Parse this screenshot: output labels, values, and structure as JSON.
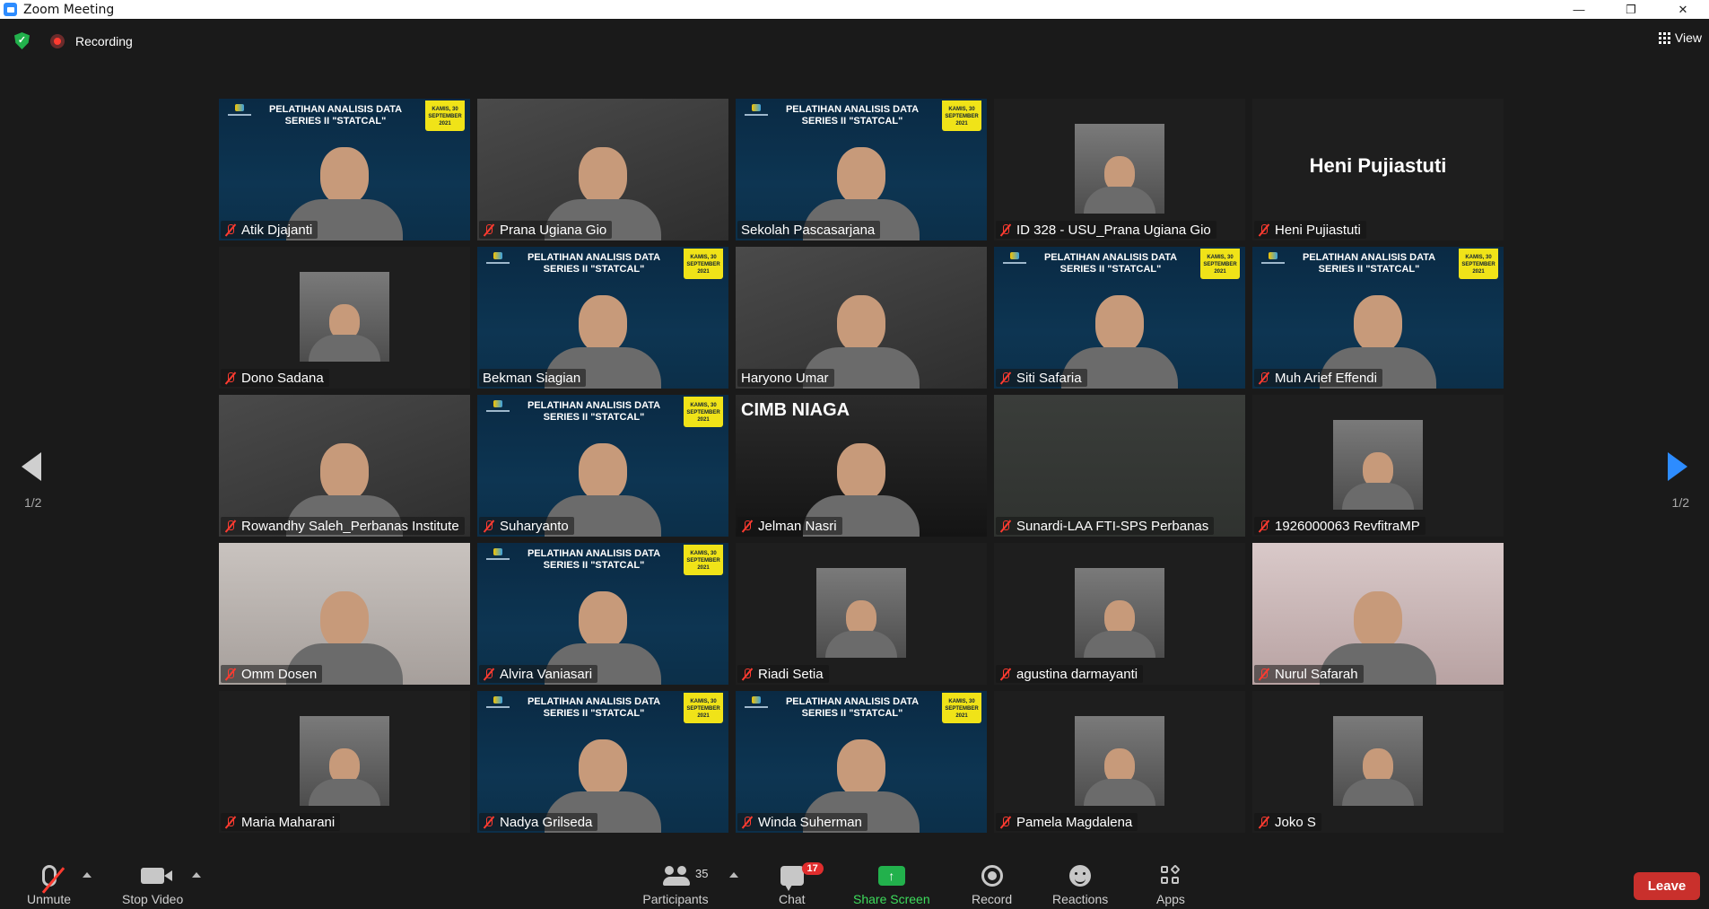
{
  "window": {
    "title": "Zoom Meeting",
    "minimize": "—",
    "restore": "❐",
    "close": "✕"
  },
  "topbar": {
    "recording_label": "Recording",
    "view_label": "View"
  },
  "banner": {
    "title": "PELATIHAN ANALISIS DATA SERIES II \"STATCAL\"",
    "date": "KAMIS, 30 SEPTEMBER 2021"
  },
  "tiles": [
    {
      "name": "Atik Djajanti",
      "muted": true,
      "bg": "banner"
    },
    {
      "name": "Prana Ugiana Gio",
      "muted": true,
      "bg": "room"
    },
    {
      "name": "Sekolah Pascasarjana",
      "muted": false,
      "bg": "banner",
      "active_speaker": true
    },
    {
      "name": "ID 328 - USU_Prana Ugiana Gio",
      "muted": true,
      "bg": "dark"
    },
    {
      "name": "Heni Pujiastuti",
      "muted": true,
      "bg": "dark",
      "display_name_card": "Heni Pujiastuti"
    },
    {
      "name": "Dono Sadana",
      "muted": true,
      "bg": "dark"
    },
    {
      "name": "Bekman Siagian",
      "muted": false,
      "bg": "banner"
    },
    {
      "name": "Haryono Umar",
      "muted": false,
      "bg": "room"
    },
    {
      "name": "Siti Safaria",
      "muted": true,
      "bg": "banner"
    },
    {
      "name": "Muh Arief Effendi",
      "muted": true,
      "bg": "banner"
    },
    {
      "name": "Rowandhy Saleh_Perbanas Institute",
      "muted": true,
      "bg": "room"
    },
    {
      "name": "Suharyanto",
      "muted": true,
      "bg": "banner"
    },
    {
      "name": "Jelman Nasri",
      "muted": true,
      "bg": "cimb",
      "overlay": "CIMB NIAGA"
    },
    {
      "name": "Sunardi-LAA FTI-SPS Perbanas",
      "muted": true,
      "bg": "grey"
    },
    {
      "name": "1926000063 RevfitraMP",
      "muted": true,
      "bg": "dark"
    },
    {
      "name": "Omm Dosen",
      "muted": true,
      "bg": "light"
    },
    {
      "name": "Alvira Vaniasari",
      "muted": true,
      "bg": "banner"
    },
    {
      "name": "Riadi Setia",
      "muted": true,
      "bg": "dark"
    },
    {
      "name": "agustina darmayanti",
      "muted": true,
      "bg": "dark"
    },
    {
      "name": "Nurul Safarah",
      "muted": true,
      "bg": "pink"
    },
    {
      "name": "Maria Maharani",
      "muted": true,
      "bg": "dark"
    },
    {
      "name": "Nadya Grilseda",
      "muted": true,
      "bg": "banner"
    },
    {
      "name": "Winda Suherman",
      "muted": true,
      "bg": "banner"
    },
    {
      "name": "Pamela Magdalena",
      "muted": true,
      "bg": "dark"
    },
    {
      "name": "Joko S",
      "muted": true,
      "bg": "dark"
    }
  ],
  "pagination": {
    "left": "1/2",
    "right": "1/2"
  },
  "toolbar": {
    "unmute": "Unmute",
    "stop_video": "Stop Video",
    "participants": "Participants",
    "participants_count": "35",
    "chat": "Chat",
    "chat_badge": "17",
    "share_screen": "Share Screen",
    "record": "Record",
    "reactions": "Reactions",
    "apps": "Apps",
    "leave": "Leave"
  },
  "colors": {
    "accent": "#2d8cff",
    "share_green": "#22b14c",
    "leave_red": "#c9302c",
    "speaker_border": "#cddc39",
    "banner_bg": "#0d3552"
  }
}
